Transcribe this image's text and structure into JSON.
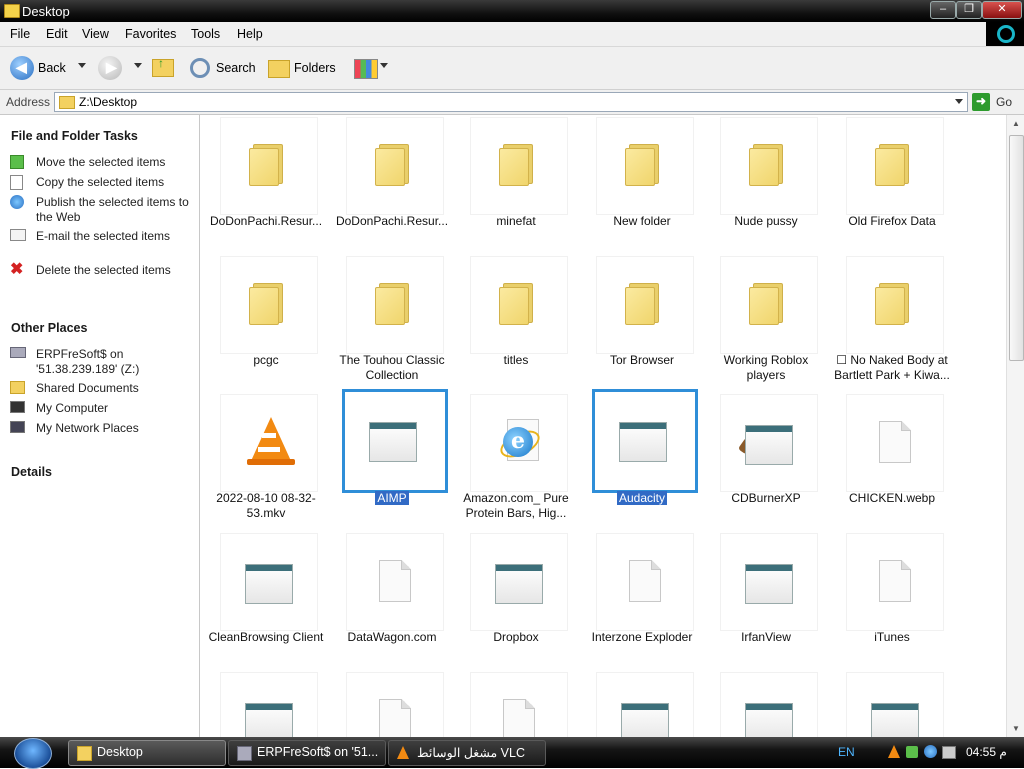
{
  "window": {
    "title": "Desktop"
  },
  "menu": [
    "File",
    "Edit",
    "View",
    "Favorites",
    "Tools",
    "Help"
  ],
  "toolbar": {
    "back": "Back",
    "search": "Search",
    "folders": "Folders"
  },
  "address": {
    "label": "Address",
    "path": "Z:\\Desktop",
    "go": "Go"
  },
  "tasks": {
    "title": "File and Folder Tasks",
    "items": [
      {
        "label": "Move the selected items"
      },
      {
        "label": "Copy the selected items"
      },
      {
        "label": "Publish the selected items to the Web"
      },
      {
        "label": "E-mail the selected items"
      },
      {
        "label": "Delete the selected items"
      }
    ]
  },
  "other_places": {
    "title": "Other Places",
    "items": [
      {
        "label": "ERPFreSoft$ on '51.38.239.189' (Z:)"
      },
      {
        "label": "Shared Documents"
      },
      {
        "label": "My Computer"
      },
      {
        "label": "My Network Places"
      }
    ]
  },
  "details": {
    "title": "Details"
  },
  "files": [
    {
      "name": "DoDonPachi.Resur...",
      "type": "folder"
    },
    {
      "name": "DoDonPachi.Resur...",
      "type": "folder"
    },
    {
      "name": "minefat",
      "type": "folder"
    },
    {
      "name": "New folder",
      "type": "folder"
    },
    {
      "name": "Nude pussy",
      "type": "folder"
    },
    {
      "name": "Old Firefox Data",
      "type": "folder"
    },
    {
      "name": "pcgc",
      "type": "folder"
    },
    {
      "name": "The Touhou Classic Collection",
      "type": "folder"
    },
    {
      "name": "titles",
      "type": "folder"
    },
    {
      "name": "Tor Browser",
      "type": "folder"
    },
    {
      "name": "Working Roblox players",
      "type": "folder"
    },
    {
      "name": "☐ No Naked Body at Bartlett Park + Kiwa...",
      "type": "folder"
    },
    {
      "name": "2022-08-10 08-32-53.mkv",
      "type": "vlc"
    },
    {
      "name": "AIMP",
      "type": "window",
      "selected": true
    },
    {
      "name": "Amazon.com_ Pure Protein Bars, Hig...",
      "type": "ie"
    },
    {
      "name": "Audacity",
      "type": "window",
      "selected": true
    },
    {
      "name": "CDBurnerXP",
      "type": "window-cd"
    },
    {
      "name": "CHICKEN.webp",
      "type": "doc"
    },
    {
      "name": "CleanBrowsing Client",
      "type": "window"
    },
    {
      "name": "DataWagon.com",
      "type": "doc"
    },
    {
      "name": "Dropbox",
      "type": "window"
    },
    {
      "name": "Interzone Exploder",
      "type": "doc"
    },
    {
      "name": "IrfanView",
      "type": "window"
    },
    {
      "name": "iTunes",
      "type": "doc"
    },
    {
      "name": "",
      "type": "window"
    },
    {
      "name": "",
      "type": "doc"
    },
    {
      "name": "",
      "type": "doc"
    },
    {
      "name": "",
      "type": "window"
    },
    {
      "name": "",
      "type": "window"
    },
    {
      "name": "",
      "type": "window"
    }
  ],
  "taskbar": {
    "buttons": [
      {
        "label": "Desktop",
        "active": true
      },
      {
        "label": "ERPFreSoft$ on '51...."
      },
      {
        "label": "مشغل الوسائط VLC"
      }
    ],
    "lang": "EN",
    "clock": "04:55 م"
  },
  "colors": {
    "selection": "#316ac5",
    "accent": "#2f8ed8",
    "folder": "#f3d160"
  }
}
